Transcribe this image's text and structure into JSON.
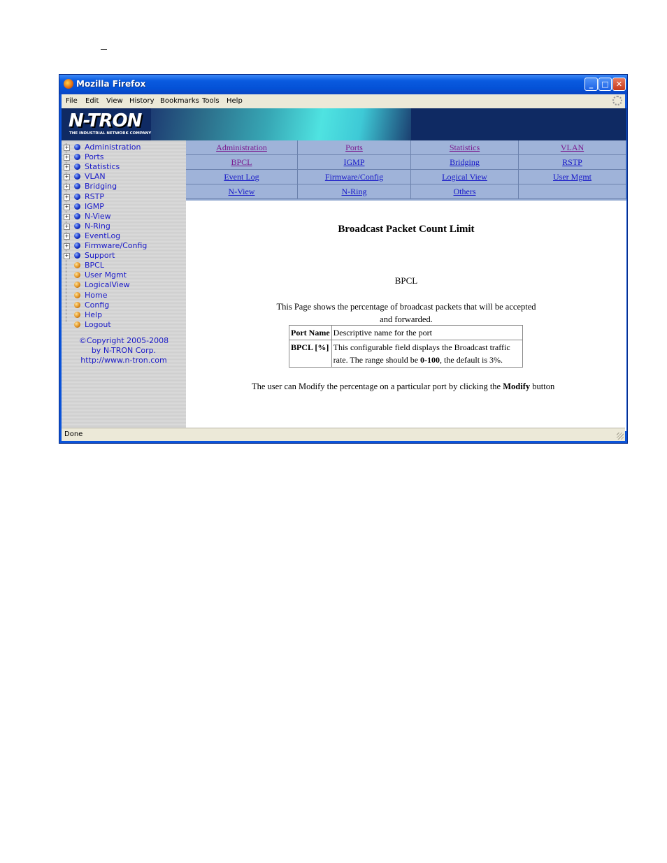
{
  "window": {
    "title": "Mozilla Firefox",
    "status": "Done"
  },
  "menubar": [
    "File",
    "Edit",
    "View",
    "History",
    "Bookmarks",
    "Tools",
    "Help"
  ],
  "banner": {
    "logo": "N-TRON",
    "tagline": "THE INDUSTRIAL NETWORK COMPANY"
  },
  "sidebar": {
    "items": [
      {
        "label": "Administration",
        "expandable": true
      },
      {
        "label": "Ports",
        "expandable": true
      },
      {
        "label": "Statistics",
        "expandable": true
      },
      {
        "label": "VLAN",
        "expandable": true
      },
      {
        "label": "Bridging",
        "expandable": true
      },
      {
        "label": "RSTP",
        "expandable": true
      },
      {
        "label": "IGMP",
        "expandable": true
      },
      {
        "label": "N-View",
        "expandable": true
      },
      {
        "label": "N-Ring",
        "expandable": true
      },
      {
        "label": "EventLog",
        "expandable": true
      },
      {
        "label": "Firmware/Config",
        "expandable": true
      },
      {
        "label": "Support",
        "expandable": true
      },
      {
        "label": "BPCL",
        "expandable": false
      },
      {
        "label": "User Mgmt",
        "expandable": false
      },
      {
        "label": "LogicalView",
        "expandable": false
      },
      {
        "label": "Home",
        "expandable": false
      },
      {
        "label": "Config",
        "expandable": false
      },
      {
        "label": "Help",
        "expandable": false
      },
      {
        "label": "Logout",
        "expandable": false
      }
    ],
    "copyright": [
      "©Copyright 2005-2008",
      "by N-TRON Corp.",
      "http://www.n-tron.com"
    ]
  },
  "nav": [
    [
      "Administration",
      "Ports",
      "Statistics",
      "VLAN"
    ],
    [
      "BPCL",
      "IGMP",
      "Bridging",
      "RSTP"
    ],
    [
      "Event Log",
      "Firmware/Config",
      "Logical View",
      "User Mgmt"
    ],
    [
      "N-View",
      "N-Ring",
      "Others",
      ""
    ]
  ],
  "page": {
    "title": "Broadcast Packet Count Limit",
    "subtitle": "BPCL",
    "desc_line1": "This Page shows the percentage of broadcast packets that will be accepted",
    "desc_line2": "and forwarded.",
    "table": [
      {
        "key": "Port Name",
        "value": "Descriptive name for the port"
      },
      {
        "key": "BPCL [%]",
        "value_pre": "This configurable field displays the Broadcast traffic rate. The range should be ",
        "value_bold": "0-100",
        "value_post": ", the default is 3%."
      }
    ],
    "note_pre": "The user can Modify the percentage on a particular port by clicking the ",
    "note_bold": "Modify",
    "note_post": " button"
  }
}
